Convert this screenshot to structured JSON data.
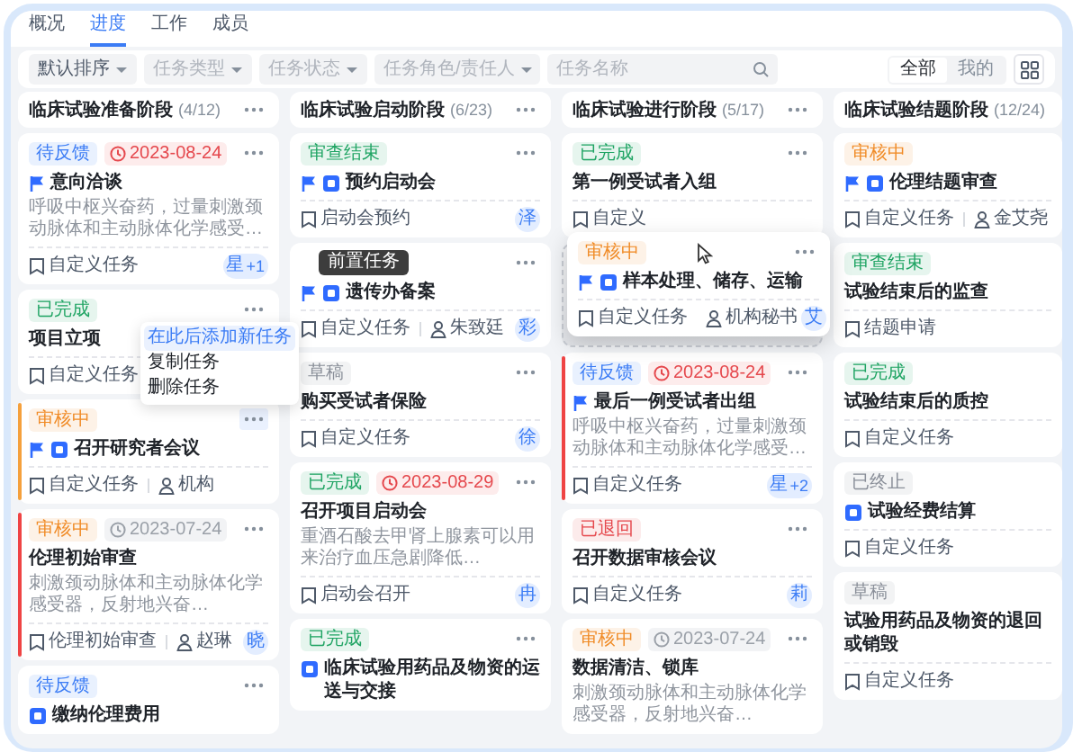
{
  "tabs": [
    {
      "label": "概况",
      "selected": false
    },
    {
      "label": "进度",
      "selected": true
    },
    {
      "label": "工作",
      "selected": false
    },
    {
      "label": "成员",
      "selected": false
    }
  ],
  "filters": [
    {
      "kind": "select",
      "value": "默认排序"
    },
    {
      "kind": "select",
      "placeholder": "任务类型"
    },
    {
      "kind": "select",
      "placeholder": "任务状态"
    },
    {
      "kind": "select",
      "placeholder": "任务角色/责任人"
    },
    {
      "kind": "search",
      "placeholder": "任务名称"
    }
  ],
  "scope": [
    {
      "label": "全部",
      "selected": true
    },
    {
      "label": "我的",
      "selected": false
    }
  ],
  "columns": [
    {
      "title": "临床试验准备阶段",
      "count": "(4/12)",
      "more_button": true,
      "cards": [
        {
          "kind": "task",
          "more_button": true,
          "status": {
            "text": "待反馈",
            "color": "#3b7cf5"
          },
          "date": {
            "text": "2023-08-24",
            "overdue": true
          },
          "flagged": true,
          "milestone": false,
          "title": "意向洽谈",
          "desc": "呼吸中枢兴奋药，过量刺激颈动脉体和主动脉体化学感受…",
          "type": "自定义任务",
          "avatar": "星",
          "avatar_extra": "+1"
        },
        {
          "kind": "task",
          "more_button": true,
          "status": {
            "text": "已完成",
            "color": "#1fa463"
          },
          "flagged": false,
          "milestone": false,
          "title": "项目立项",
          "type": "自定义任务"
        },
        {
          "kind": "task",
          "more_button": true,
          "color": "#f5a03c",
          "status": {
            "text": "审核中",
            "color": "#f08a24"
          },
          "flagged": true,
          "milestone": true,
          "title": "召开研究者会议",
          "type": "自定义任务",
          "owner": "机构",
          "menu": [
            {
              "label": "在此后添加新任务",
              "selected": true
            },
            {
              "label": "复制任务",
              "selected": false
            },
            {
              "label": "删除任务",
              "selected": false
            }
          ]
        },
        {
          "kind": "task",
          "more_button": true,
          "color": "#ef4444",
          "status": {
            "text": "审核中",
            "color": "#f08a24"
          },
          "date": {
            "text": "2023-07-24",
            "overdue": false
          },
          "flagged": false,
          "milestone": false,
          "title": "伦理初始审查",
          "desc": "刺激颈动脉体和主动脉体化学感受器，反射地兴奋…",
          "type": "伦理初始审查",
          "owner": "赵琳",
          "avatar": "晓"
        },
        {
          "kind": "task",
          "more_button": true,
          "status": {
            "text": "待反馈",
            "color": "#3b7cf5"
          },
          "flagged": false,
          "milestone": true,
          "title": "缴纳伦理费用"
        }
      ]
    },
    {
      "title": "临床试验启动阶段",
      "count": "(6/23)",
      "more_button": true,
      "cards": [
        {
          "kind": "task",
          "more_button": true,
          "status": {
            "text": "审查结束",
            "color": "#1fa463"
          },
          "flagged": true,
          "milestone": true,
          "title": "预约启动会",
          "type": "启动会预约",
          "avatar": "泽"
        },
        {
          "kind": "task",
          "more_button": true,
          "tooltip": "前置任务",
          "flagged": true,
          "milestone": true,
          "title": "遗传办备案",
          "type": "自定义任务",
          "owner": "朱致廷",
          "avatar": "彩"
        },
        {
          "kind": "task",
          "more_button": true,
          "status": {
            "text": "草稿",
            "color": "#8a8f99"
          },
          "flagged": false,
          "milestone": false,
          "title": "购买受试者保险",
          "type": "自定义任务",
          "avatar": "徐"
        },
        {
          "kind": "task",
          "more_button": true,
          "status": {
            "text": "已完成",
            "color": "#1fa463"
          },
          "date": {
            "text": "2023-08-29",
            "overdue": true
          },
          "flagged": false,
          "milestone": false,
          "title": "召开项目启动会",
          "desc": "重酒石酸去甲肾上腺素可以用来治疗血压急剧降低…",
          "type": "启动会召开",
          "avatar": "冉"
        },
        {
          "kind": "task",
          "more_button": true,
          "status": {
            "text": "已完成",
            "color": "#1fa463"
          },
          "flagged": false,
          "milestone": true,
          "title": "临床试验用药品及物资的运送与交接"
        }
      ]
    },
    {
      "title": "临床试验进行阶段",
      "count": "(5/17)",
      "more_button": true,
      "dragged_card": {
        "kind": "task",
        "more_button": true,
        "status": {
          "text": "审核中",
          "color": "#f08a24"
        },
        "flagged": true,
        "milestone": true,
        "title": "样本处理、储存、运输",
        "type": "自定义任务",
        "owner": "机构秘书",
        "avatar": "艾"
      },
      "cards": [
        {
          "kind": "task",
          "more_button": true,
          "status": {
            "text": "已完成",
            "color": "#1fa463"
          },
          "flagged": false,
          "milestone": false,
          "title": "第一例受试者入组",
          "type": "自定义"
        },
        {
          "kind": "drop_placeholder"
        },
        {
          "kind": "task",
          "more_button": true,
          "color": "#ef4444",
          "status": {
            "text": "待反馈",
            "color": "#3b7cf5"
          },
          "date": {
            "text": "2023-08-24",
            "overdue": true
          },
          "flagged": true,
          "milestone": false,
          "title": "最后一例受试者出组",
          "desc": "呼吸中枢兴奋药，过量刺激颈动脉体和主动脉体化学感受…",
          "type": "自定义任务",
          "avatar": "星",
          "avatar_extra": "+2"
        },
        {
          "kind": "task",
          "more_button": true,
          "status": {
            "text": "已退回",
            "color": "#e5484d"
          },
          "flagged": false,
          "milestone": false,
          "title": "召开数据审核会议",
          "type": "自定义任务",
          "avatar": "莉"
        },
        {
          "kind": "task",
          "more_button": true,
          "status": {
            "text": "审核中",
            "color": "#f08a24"
          },
          "date": {
            "text": "2023-07-24",
            "overdue": false
          },
          "flagged": false,
          "milestone": false,
          "title": "数据清洁、锁库",
          "desc": "刺激颈动脉体和主动脉体化学感受器，反射地兴奋…"
        }
      ]
    },
    {
      "title": "临床试验结题阶段",
      "count": "(12/24)",
      "more_button": false,
      "cards": [
        {
          "kind": "task",
          "more_button": false,
          "status": {
            "text": "审核中",
            "color": "#f08a24"
          },
          "flagged": true,
          "milestone": true,
          "title": "伦理结题审查",
          "type": "自定义任务",
          "owner": "金艾尧"
        },
        {
          "kind": "task",
          "more_button": false,
          "status": {
            "text": "审查结束",
            "color": "#1fa463"
          },
          "flagged": false,
          "milestone": false,
          "title": "试验结束后的监查",
          "type": "结题申请"
        },
        {
          "kind": "task",
          "more_button": false,
          "status": {
            "text": "已完成",
            "color": "#1fa463"
          },
          "flagged": false,
          "milestone": false,
          "title": "试验结束后的质控",
          "type": "自定义任务"
        },
        {
          "kind": "task",
          "more_button": false,
          "status": {
            "text": "已终止",
            "color": "#8a8f99"
          },
          "flagged": false,
          "milestone": true,
          "title": "试验经费结算",
          "type": "自定义任务"
        },
        {
          "kind": "task",
          "more_button": false,
          "status": {
            "text": "草稿",
            "color": "#8a8f99"
          },
          "flagged": false,
          "milestone": false,
          "title": "试验用药品及物资的退回或销毁",
          "type": "自定义任务"
        }
      ]
    }
  ]
}
